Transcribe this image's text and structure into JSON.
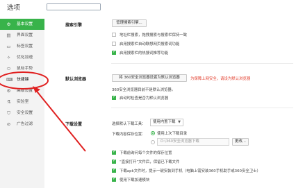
{
  "header": {
    "title": "选项",
    "search_placeholder": ""
  },
  "sidebar": {
    "items": [
      {
        "label": "基本设置",
        "icon": "gear-icon",
        "glyph": "⚙"
      },
      {
        "label": "界面设置",
        "icon": "layout-icon",
        "glyph": "▤"
      },
      {
        "label": "标签设置",
        "icon": "tab-icon",
        "glyph": "▭"
      },
      {
        "label": "优化加速",
        "icon": "rocket-icon",
        "glyph": "✧"
      },
      {
        "label": "鼠标手势",
        "icon": "mouse-icon",
        "glyph": "⬭"
      },
      {
        "label": "快捷键",
        "icon": "keyboard-icon",
        "glyph": "⌨"
      },
      {
        "label": "高级设置",
        "icon": "settings-icon",
        "glyph": "⚙"
      },
      {
        "label": "实验室",
        "icon": "flask-icon",
        "glyph": "⚗"
      },
      {
        "label": "安全设置",
        "icon": "shield-icon",
        "glyph": "⛉"
      },
      {
        "label": "广告过滤",
        "icon": "filter-icon",
        "glyph": "⊘"
      }
    ]
  },
  "search_engine": {
    "title": "搜索引擎",
    "manage_button": "管理搜索引擎...",
    "options": [
      {
        "label": "地址栏搜索，拖拽搜索与搜索栏保持一致",
        "checked": false
      },
      {
        "label": "启用搜索栏自动联想网页搜索词功能",
        "checked": false
      },
      {
        "label": "启用搜索栏的热搜词推荐功能",
        "checked": true
      }
    ]
  },
  "default_browser": {
    "title": "默认浏览器",
    "set_button": "将 360安全浏览器设置为默认浏览器",
    "warning": "为保障上网安全，请设为默认浏览器",
    "status": "360安全浏览器目前不是默认浏览器。",
    "option": {
      "label": "启动时检查是否为默认浏览器",
      "checked": true
    }
  },
  "download": {
    "title": "下载设置",
    "tool_label": "选择默认下载工具：",
    "tool_value": "使用内置下载",
    "location_label": "下载内容保存位置：",
    "radio_label": "使用上次下载目录",
    "path_value": "D:\\360安全浏览器下载",
    "change_button": "更改...",
    "options": [
      {
        "label": "下载前询问每个文件的保存位置",
        "checked": true
      },
      {
        "label": "“直接打开”文件后，保留已下载文件",
        "checked": true
      },
      {
        "label": "下载apk文件时，提示一键安装到手机（电脑上需安装360手机助手或360安全卫士）",
        "checked": true
      },
      {
        "label": "使用下载加速模块",
        "checked": true
      }
    ]
  }
}
